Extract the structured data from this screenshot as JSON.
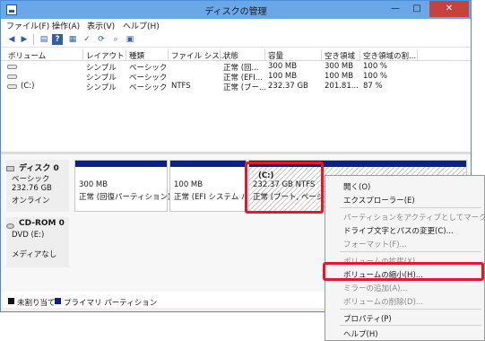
{
  "window": {
    "title": "ディスクの管理",
    "min_label": "—",
    "max_label": "□",
    "close_label": "✕"
  },
  "menubar": {
    "items": [
      "ファイル(F)",
      "操作(A)",
      "表示(V)",
      "ヘルプ(H)"
    ]
  },
  "toolbar": {
    "icons": [
      "back-arrow-icon",
      "forward-arrow-icon",
      "list-view-icon",
      "help-icon",
      "disk-list-icon",
      "properties-icon",
      "refresh-icon",
      "rescan-icon",
      "volume-icon"
    ]
  },
  "volume_table": {
    "headers": [
      "ボリューム",
      "レイアウト",
      "種類",
      "ファイル シス...",
      "状態",
      "容量",
      "空き領域",
      "空き領域の割..."
    ],
    "rows": [
      [
        "",
        "シンプル",
        "ベーシック",
        "",
        "正常 (回...",
        "300 MB",
        "300 MB",
        "100 %"
      ],
      [
        "",
        "シンプル",
        "ベーシック",
        "",
        "正常 (EFI...",
        "100 MB",
        "100 MB",
        "100 %"
      ],
      [
        "(C:)",
        "シンプル",
        "ベーシック",
        "NTFS",
        "正常 (ブー...",
        "232.37 GB",
        "201.81...",
        "87 %"
      ]
    ]
  },
  "disk0": {
    "title": "ディスク 0",
    "type": "ベーシック",
    "size": "232.76 GB",
    "status": "オンライン",
    "partitions": [
      {
        "size": "300 MB",
        "desc": "正常 (回復パーティション)"
      },
      {
        "size": "100 MB",
        "desc": "正常 (EFI システム パー"
      },
      {
        "name": "(C:)",
        "size": "232.37 GB NTFS",
        "desc": "正常 (ブート, ページ ファ"
      }
    ]
  },
  "cdrom0": {
    "title": "CD-ROM 0",
    "drive": "DVD (E:)",
    "status": "メディアなし"
  },
  "legend": [
    {
      "label": "未割り当て",
      "color": "#111111"
    },
    {
      "label": "プライマリ パーティション",
      "color": "#0c1f8a"
    }
  ],
  "context_menu": {
    "items": [
      {
        "label": "開く(O)",
        "enabled": true
      },
      {
        "label": "エクスプローラー(E)",
        "enabled": true
      },
      {
        "label": "パーティションをアクティブとしてマーク(M)",
        "enabled": false
      },
      {
        "label": "ドライブ文字とパスの変更(C)...",
        "enabled": true
      },
      {
        "label": "フォーマット(F)...",
        "enabled": false
      },
      {
        "label": "ボリュームの拡張(X)...",
        "enabled": false
      },
      {
        "label": "ボリュームの縮小(H)...",
        "enabled": true
      },
      {
        "label": "ミラーの追加(A)...",
        "enabled": false
      },
      {
        "label": "ボリュームの削除(D)...",
        "enabled": false
      },
      {
        "label": "プロパティ(P)",
        "enabled": true
      },
      {
        "label": "ヘルプ(H)",
        "enabled": true
      }
    ]
  },
  "colors": {
    "highlight": "#e8152b",
    "primary_partition": "#0c1f8a",
    "titlebar": "#6aa7e8"
  }
}
